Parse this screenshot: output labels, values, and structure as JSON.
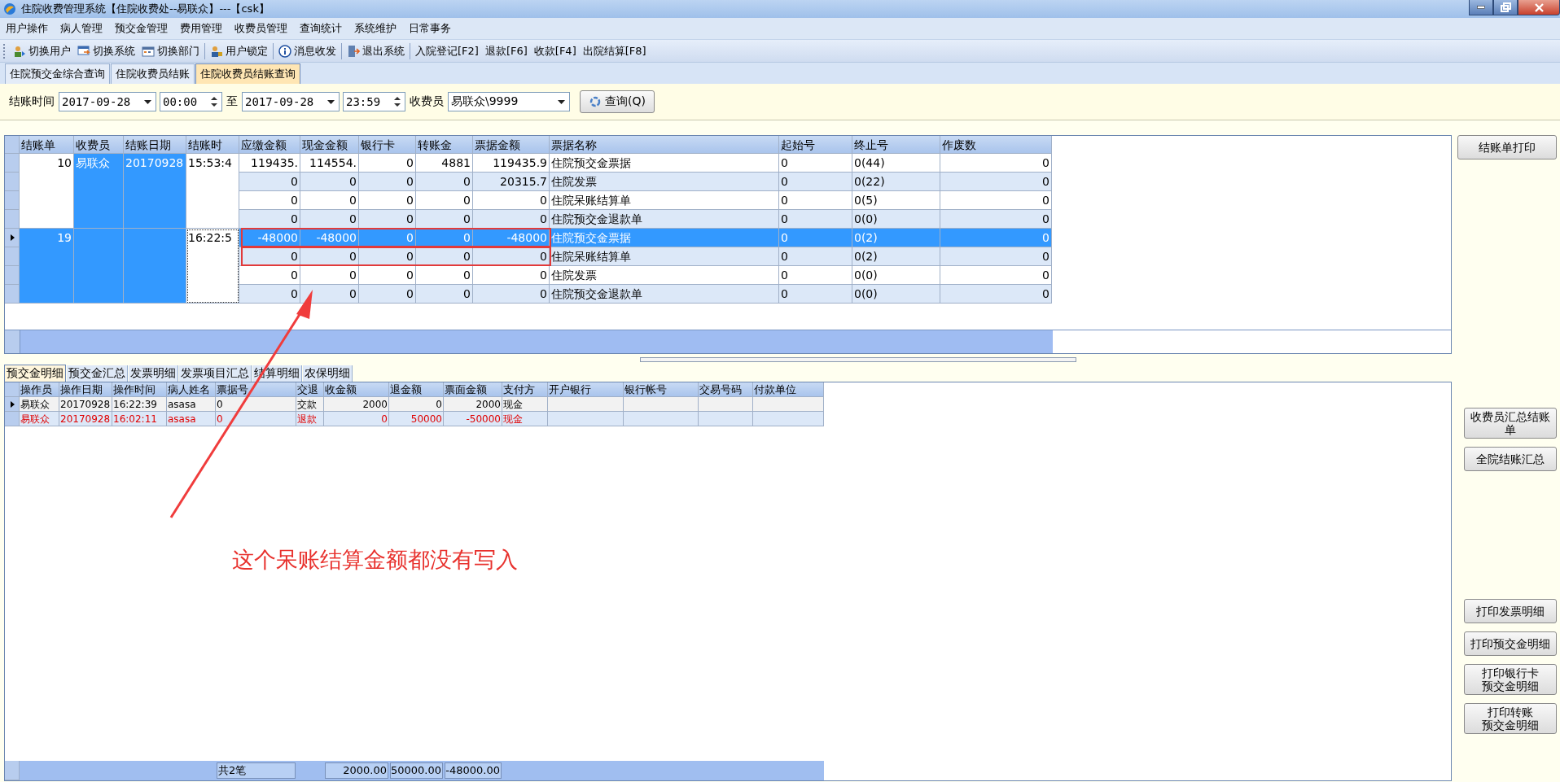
{
  "window": {
    "title": "住院收费管理系统【住院收费处--易联众】---【csk】"
  },
  "menu": [
    "用户操作",
    "病人管理",
    "预交金管理",
    "费用管理",
    "收费员管理",
    "查询统计",
    "系统维护",
    "日常事务"
  ],
  "toolbar": [
    [
      {
        "label": "切换用户",
        "kind": "icon"
      },
      {
        "label": "切换系统",
        "kind": "icon"
      },
      {
        "label": "切换部门",
        "kind": "icon"
      }
    ],
    [
      {
        "label": "用户锁定",
        "kind": "icon"
      }
    ],
    [
      {
        "label": "消息收发",
        "kind": "icon"
      }
    ],
    [
      {
        "label": "退出系统",
        "kind": "icon"
      }
    ],
    [
      {
        "label": "入院登记[F2]",
        "kind": "text"
      },
      {
        "label": "退款[F6]",
        "kind": "text"
      },
      {
        "label": "收款[F4]",
        "kind": "text"
      },
      {
        "label": "出院结算[F8]",
        "kind": "text"
      }
    ]
  ],
  "tabs": [
    {
      "label": "住院预交金综合查询",
      "selected": false
    },
    {
      "label": "住院收费员结账",
      "selected": false
    },
    {
      "label": "住院收费员结账查询",
      "selected": true
    }
  ],
  "filter": {
    "time_label": "结账时间",
    "from_date": "2017-09-28",
    "from_time": "00:00",
    "to_label": "至",
    "to_date": "2017-09-28",
    "to_time": "23:59",
    "cashier_label": "收费员",
    "cashier": "易联众\\9999",
    "query_button": "查询(Q)"
  },
  "grid": {
    "group_columns": [
      {
        "label": "结账单",
        "highlighted": false
      },
      {
        "label": "收费员",
        "highlighted": true
      },
      {
        "label": "结账日期",
        "highlighted": true
      },
      {
        "label": "结账时",
        "highlighted": false
      }
    ],
    "detail_columns": [
      "应缴金额",
      "现金金额",
      "银行卡",
      "转账金",
      "票据金额",
      "票据名称",
      "起始号",
      "终止号",
      "作废数"
    ],
    "groups": [
      {
        "number": "10",
        "cashier": "易联众",
        "date": "20170928",
        "time": "15:53:4",
        "selected": false,
        "focused": false,
        "rows": [
          {
            "cells": [
              "119435.",
              "114554.",
              "0",
              "4881",
              "119435.9",
              "住院预交金票据",
              "0",
              "0(44)",
              "0"
            ],
            "selected": false,
            "boxed": false
          },
          {
            "cells": [
              "0",
              "0",
              "0",
              "0",
              "20315.7",
              "住院发票",
              "0",
              "0(22)",
              "0"
            ],
            "selected": false,
            "boxed": false
          },
          {
            "cells": [
              "0",
              "0",
              "0",
              "0",
              "0",
              "住院呆账结算单",
              "0",
              "0(5)",
              "0"
            ],
            "selected": false,
            "boxed": false
          },
          {
            "cells": [
              "0",
              "0",
              "0",
              "0",
              "0",
              "住院预交金退款单",
              "0",
              "0(0)",
              "0"
            ],
            "selected": false,
            "boxed": false
          }
        ]
      },
      {
        "number": "19",
        "time": "16:22:5",
        "selected": true,
        "focused": true,
        "rows": [
          {
            "cells": [
              "-48000",
              "-48000",
              "0",
              "0",
              "-48000",
              "住院预交金票据",
              "0",
              "0(2)",
              "0"
            ],
            "selected": true,
            "boxed": true
          },
          {
            "cells": [
              "0",
              "0",
              "0",
              "0",
              "0",
              "住院呆账结算单",
              "0",
              "0(2)",
              "0"
            ],
            "selected": false,
            "boxed": true
          },
          {
            "cells": [
              "0",
              "0",
              "0",
              "0",
              "0",
              "住院发票",
              "0",
              "0(0)",
              "0"
            ],
            "selected": false,
            "boxed": false
          },
          {
            "cells": [
              "0",
              "0",
              "0",
              "0",
              "0",
              "住院预交金退款单",
              "0",
              "0(0)",
              "0"
            ],
            "selected": false,
            "boxed": false
          }
        ]
      }
    ]
  },
  "detail_tabs": [
    {
      "label": "预交金明细",
      "selected": true
    },
    {
      "label": "预交金汇总",
      "selected": false
    },
    {
      "label": "发票明细",
      "selected": false
    },
    {
      "label": "发票项目汇总",
      "selected": false
    },
    {
      "label": "结算明细",
      "selected": false
    },
    {
      "label": "农保明细",
      "selected": false
    }
  ],
  "detail": {
    "columns": [
      "操作员",
      "操作日期",
      "操作时间",
      "病人姓名",
      "票据号",
      "交退",
      "收金额",
      "退金额",
      "票面金额",
      "支付方",
      "开户银行",
      "银行帐号",
      "交易号码",
      "付款单位"
    ],
    "rows": [
      {
        "current": true,
        "kind": "payment",
        "cells": [
          "易联众",
          "20170928",
          "16:22:39",
          "asasa",
          "0",
          "交款",
          "2000",
          "0",
          "2000",
          "现金"
        ]
      },
      {
        "current": false,
        "kind": "refund",
        "cells": [
          "易联众",
          "20170928",
          "16:02:11",
          "asasa",
          "0",
          "退款",
          "0",
          "50000",
          "-50000",
          "现金"
        ]
      }
    ],
    "footer": {
      "count": "共2笔",
      "received": "2000.00",
      "refunded": "50000.00",
      "face_total": "-48000.00"
    }
  },
  "side_buttons": [
    [
      "结账单打印"
    ],
    [
      "收费员汇总结账单",
      "全院结账汇总"
    ],
    [
      "打印发票明细",
      "打印预交金明细",
      "打印银行卡预交金明细",
      "打印转账预交金明细"
    ]
  ],
  "annotation": {
    "text": "这个呆账结算金额都没有写入"
  }
}
